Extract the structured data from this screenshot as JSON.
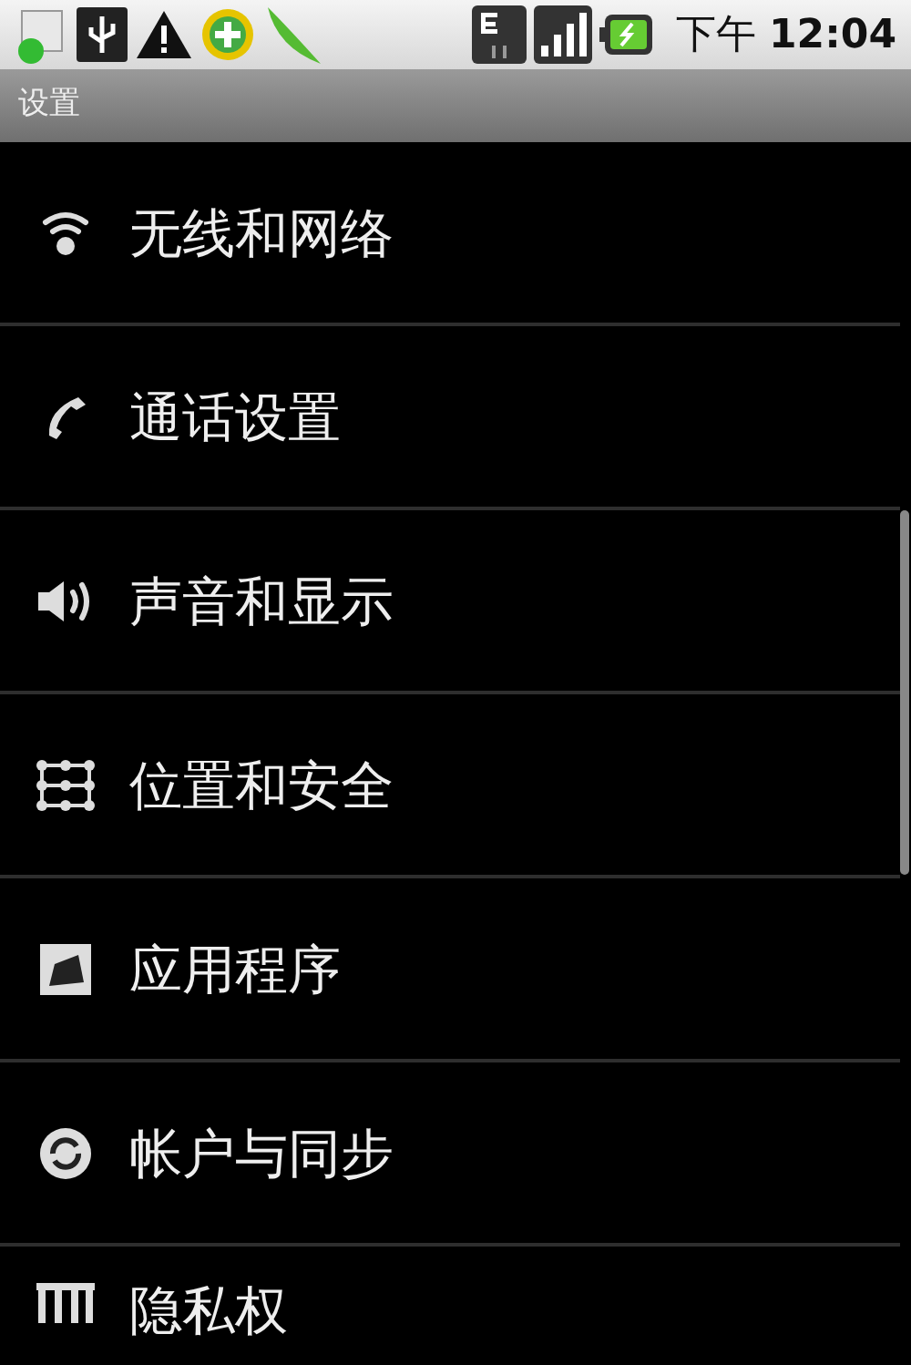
{
  "status_bar": {
    "time": "下午 **12:04**"
  },
  "title_bar": {
    "title": "设置"
  },
  "settings_list": [
    {
      "label": "无线和网络"
    },
    {
      "label": "通话设置"
    },
    {
      "label": "声音和显示"
    },
    {
      "label": "位置和安全"
    },
    {
      "label": "应用程序"
    },
    {
      "label": "帐户与同步"
    },
    {
      "label": "隐私权"
    }
  ]
}
